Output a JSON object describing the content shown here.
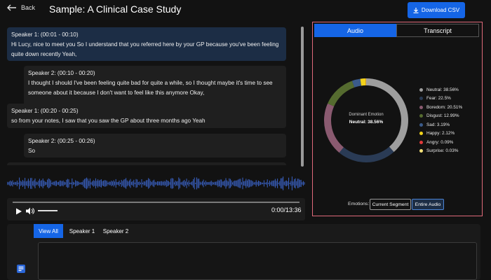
{
  "header": {
    "back_label": "Back",
    "title": "Sample: A Clinical Case Study",
    "download_label": "Download CSV"
  },
  "transcript": [
    {
      "speaker": "Speaker 1: (00:01 - 00:10)",
      "text": "Hi Lucy, nice to meet you So I understand that you referred here by your GP because you've been feeling quite down recently Yeah,"
    },
    {
      "speaker": "Speaker 2: (00:10 - 00:20)",
      "text": "I thought I should I've been feeling quite bad for quite a while, so I thought maybe it's time to see someone about it because I don't want to feel like this anymore Okay,"
    },
    {
      "speaker": "Speaker 1: (00:20 - 00:25)",
      "text": "so from your notes, I saw that you saw the GP about three months ago Yeah"
    },
    {
      "speaker": "Speaker 2: (00:25 - 00:26)",
      "text": "So"
    }
  ],
  "player": {
    "time": "0:00/13:36",
    "progress": 0.0,
    "volume": 1.0
  },
  "panel": {
    "tabs": [
      "Audio",
      "Transcript"
    ],
    "active_tab": "Audio",
    "center_title": "Dominant Emotion",
    "center_value": "Neutral: 38.56%",
    "emotions_label": "Emotions:",
    "segment_buttons": [
      "Current Segment",
      "Entire Audio"
    ],
    "active_segment": "Entire Audio"
  },
  "chart_data": {
    "type": "pie",
    "donut": true,
    "categories": [
      "Neutral",
      "Fear",
      "Boredom",
      "Disgust",
      "Sad",
      "Happy",
      "Angry",
      "Surprise"
    ],
    "values": [
      38.56,
      22.5,
      20.51,
      12.99,
      3.19,
      2.12,
      0.09,
      0.03
    ],
    "colors": [
      "#9e9e9e",
      "#2a3b55",
      "#8a5a70",
      "#556b2f",
      "#3b5b8a",
      "#f2d21a",
      "#e03a3a",
      "#f5e27a"
    ],
    "legend": [
      "Neutral: 38.56%",
      "Fear: 22.5%",
      "Boredom: 20.51%",
      "Disgust: 12.99%",
      "Sad: 3.19%",
      "Happy: 2.12%",
      "Angry: 0.09%",
      "Surprise: 0.03%"
    ]
  },
  "bottom": {
    "tabs": [
      "View All",
      "Speaker 1",
      "Speaker 2"
    ],
    "active_tab": "View All"
  },
  "colors": {
    "accent": "#1565e6",
    "highlight_border": "#e06a7a",
    "speaker1_bubble": "#1c2d45",
    "speaker2_bubble": "#1f1f1f"
  }
}
